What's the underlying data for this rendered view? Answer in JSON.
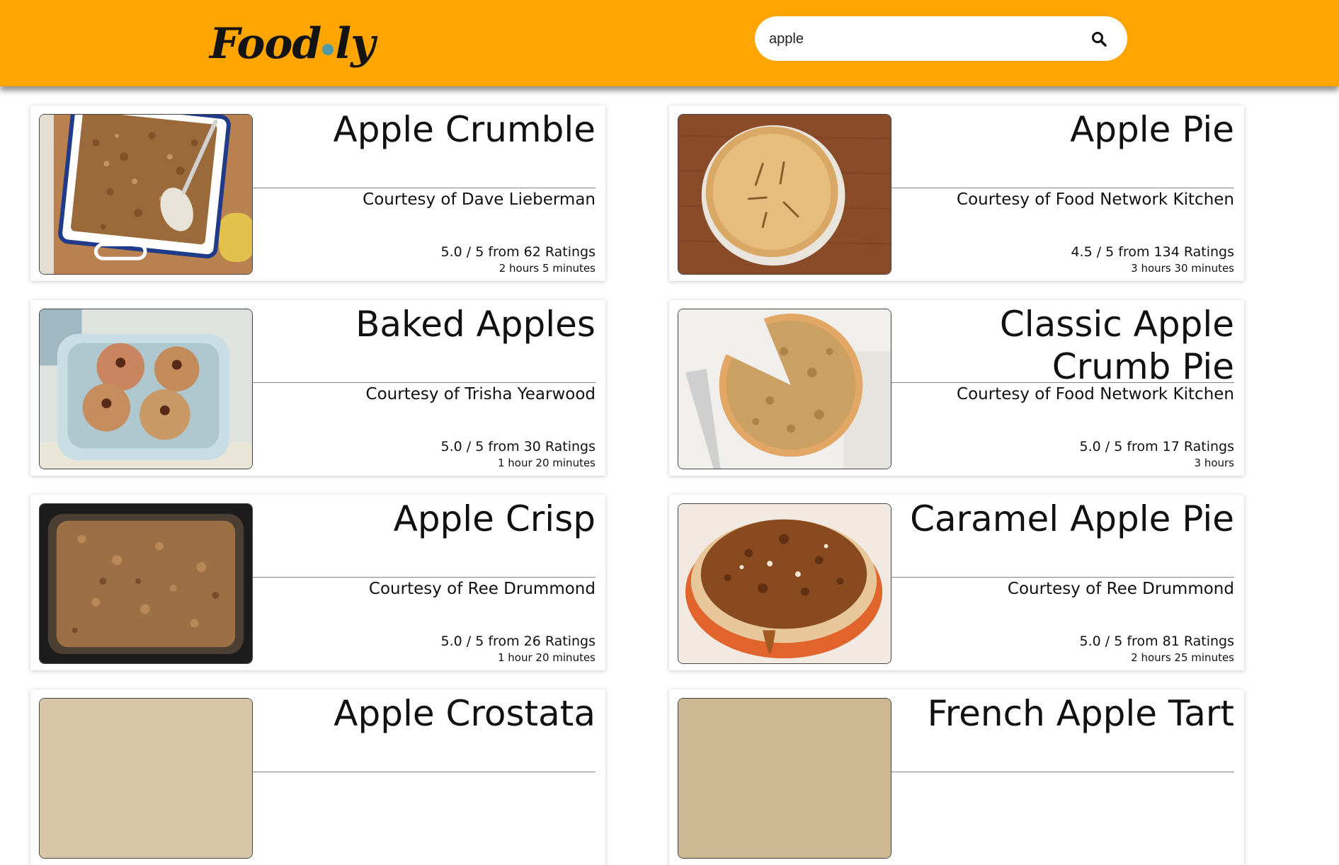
{
  "header": {
    "logo_text_left": "Food",
    "logo_text_right": "ly",
    "brand_color": "#ffa500",
    "logo_dot_color": "#4f9aa6"
  },
  "search": {
    "value": "apple",
    "icon": "search-icon"
  },
  "recipes": [
    {
      "title": "Apple Crumble",
      "author": "Courtesy of Dave Lieberman",
      "rating": "5.0 / 5 from 62 Ratings",
      "time": "2 hours 5 minutes"
    },
    {
      "title": "Apple Pie",
      "author": "Courtesy of Food Network Kitchen",
      "rating": "4.5 / 5 from 134 Ratings",
      "time": "3 hours 30 minutes"
    },
    {
      "title": "Baked Apples",
      "author": "Courtesy of Trisha Yearwood",
      "rating": "5.0 / 5 from 30 Ratings",
      "time": "1 hour 20 minutes"
    },
    {
      "title": "Classic Apple Crumb Pie",
      "author": "Courtesy of Food Network Kitchen",
      "rating": "5.0 / 5 from 17 Ratings",
      "time": "3 hours"
    },
    {
      "title": "Apple Crisp",
      "author": "Courtesy of Ree Drummond",
      "rating": "5.0 / 5 from 26 Ratings",
      "time": "1 hour 20 minutes"
    },
    {
      "title": "Caramel Apple Pie",
      "author": "Courtesy of Ree Drummond",
      "rating": "5.0 / 5 from 81 Ratings",
      "time": "2 hours 25 minutes"
    },
    {
      "title": "Apple Crostata",
      "author": "",
      "rating": "",
      "time": ""
    },
    {
      "title": "French Apple Tart",
      "author": "",
      "rating": "",
      "time": ""
    }
  ]
}
